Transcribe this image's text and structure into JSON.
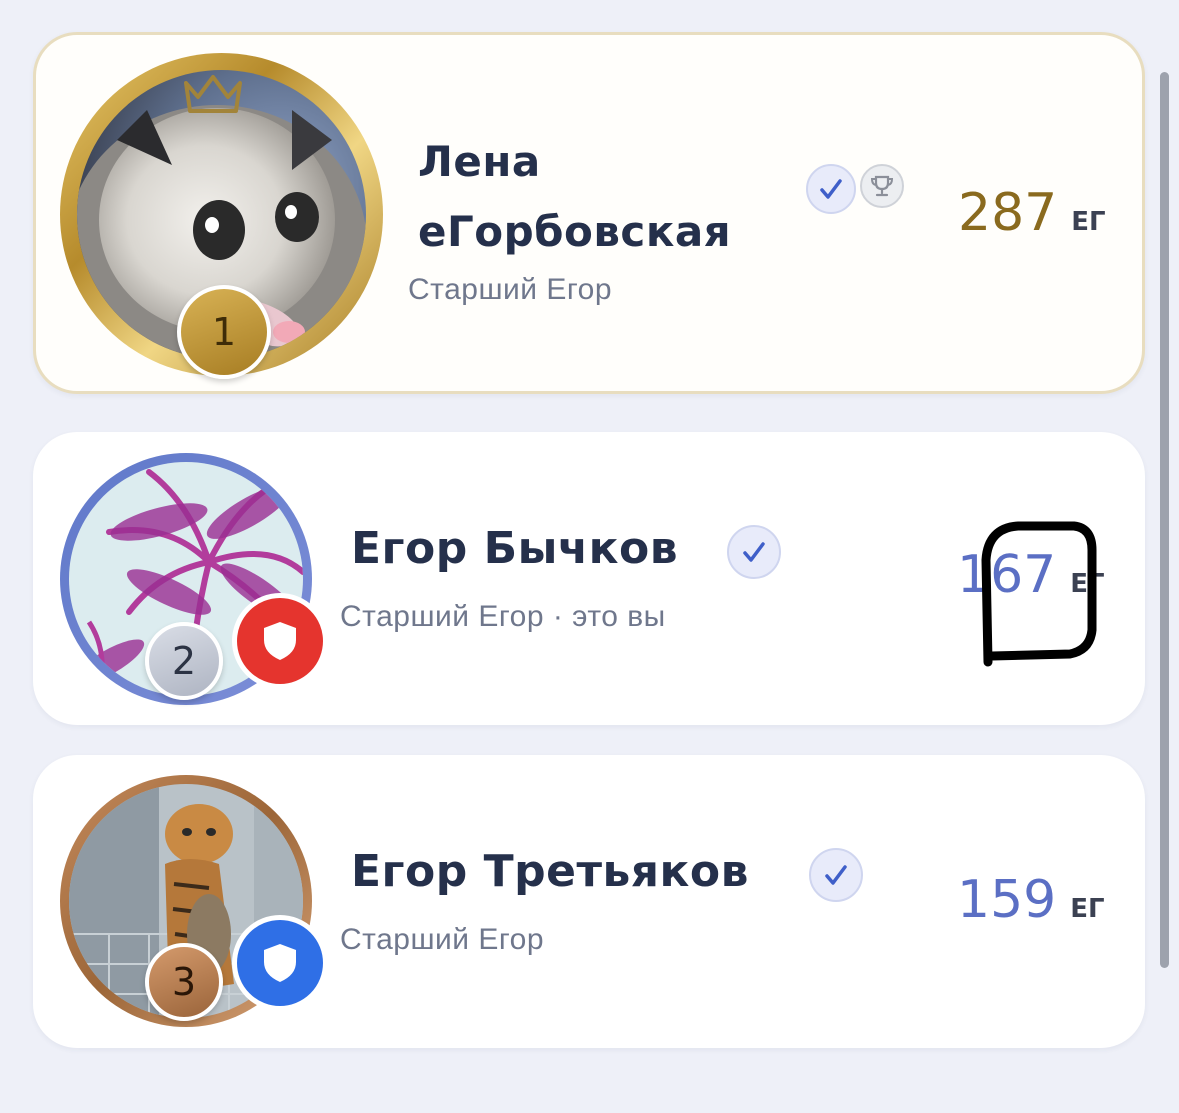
{
  "leaderboard": [
    {
      "rank": "1",
      "name_line1": "Лена",
      "name_line2": "еГорбовская",
      "role": "Старший Егор",
      "score": "287",
      "unit": "ЕГ",
      "verified_icon": "check-icon",
      "trophy_icon": "trophy-icon",
      "crown_icon": "crown-icon",
      "medal_color": "#b8912f",
      "ring_color": "#c9a24a"
    },
    {
      "rank": "2",
      "name": "Егор Бычков",
      "role": "Старший Егор · это вы",
      "score": "167",
      "unit": "ЕГ",
      "verified_icon": "check-icon",
      "shield_icon": "shield-icon",
      "shield_color": "#e5342e",
      "ring_color": "#6a7fd0"
    },
    {
      "rank": "3",
      "name": "Егор Третьяков",
      "role": "Старший Егор",
      "score": "159",
      "unit": "ЕГ",
      "verified_icon": "check-icon",
      "shield_icon": "shield-icon",
      "shield_color": "#2f6fe6",
      "ring_color": "#b67a4c"
    }
  ],
  "colors": {
    "background": "#eef0f8",
    "name_text": "#25304b",
    "role_text": "#6f778c",
    "gold_score": "#8a6a1e",
    "blue_score": "#5b6fc4"
  }
}
